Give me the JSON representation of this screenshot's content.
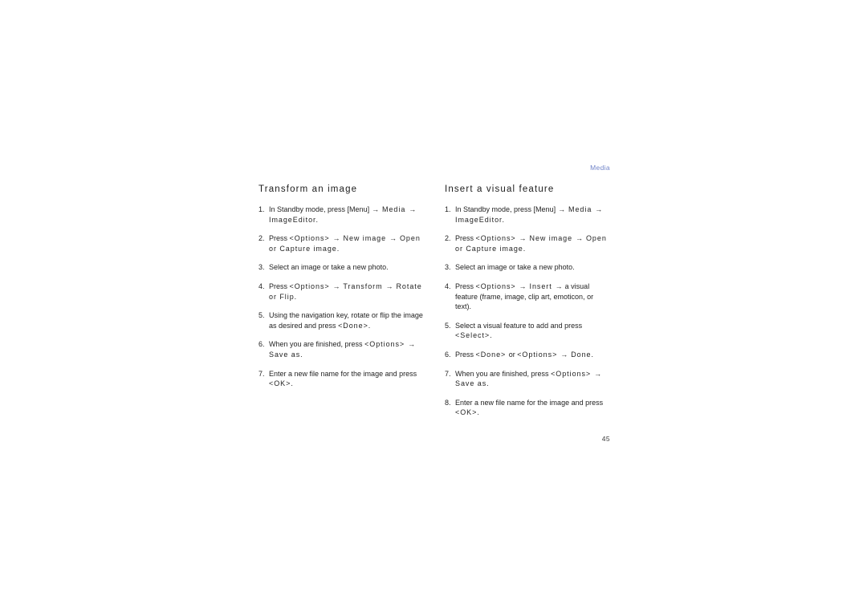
{
  "header": {
    "running_head": "Media",
    "running_head_color": "#7184c9"
  },
  "page_number": "45",
  "columns": [
    {
      "id": "transform-an-image",
      "title": "Transform an image",
      "steps": [
        {
          "num": "1.",
          "parts": [
            {
              "text": "In Standby mode, press [Menu] ",
              "style": "normal"
            },
            {
              "text": "→",
              "style": "arrow"
            },
            {
              "text": " Media ",
              "style": "menu"
            },
            {
              "text": "→",
              "style": "arrow"
            },
            {
              "text": " ImageEditor.",
              "style": "menu"
            }
          ]
        },
        {
          "num": "2.",
          "parts": [
            {
              "text": "Press ",
              "style": "normal"
            },
            {
              "text": "<Options> ",
              "style": "menu"
            },
            {
              "text": "→",
              "style": "arrow"
            },
            {
              "text": " New image ",
              "style": "menu"
            },
            {
              "text": "→",
              "style": "arrow"
            },
            {
              "text": " Open or Capture image.",
              "style": "menu"
            }
          ]
        },
        {
          "num": "3.",
          "parts": [
            {
              "text": "Select an image or take a new photo.",
              "style": "normal"
            }
          ]
        },
        {
          "num": "4.",
          "parts": [
            {
              "text": "Press ",
              "style": "normal"
            },
            {
              "text": "<Options> ",
              "style": "menu"
            },
            {
              "text": "→",
              "style": "arrow"
            },
            {
              "text": " Transform ",
              "style": "menu"
            },
            {
              "text": "→",
              "style": "arrow"
            },
            {
              "text": " Rotate or Flip.",
              "style": "menu"
            }
          ]
        },
        {
          "num": "5.",
          "parts": [
            {
              "text": "Using the navigation key, rotate or flip the image as desired and press ",
              "style": "normal"
            },
            {
              "text": "<Done>.",
              "style": "menu"
            }
          ]
        },
        {
          "num": "6.",
          "parts": [
            {
              "text": "When you are finished, press ",
              "style": "normal"
            },
            {
              "text": "<Options> ",
              "style": "menu"
            },
            {
              "text": "→",
              "style": "arrow"
            },
            {
              "text": " Save as.",
              "style": "menu"
            }
          ]
        },
        {
          "num": "7.",
          "parts": [
            {
              "text": "Enter a new file name for the image and press ",
              "style": "normal"
            },
            {
              "text": "<OK>.",
              "style": "menu"
            }
          ]
        }
      ]
    },
    {
      "id": "insert-a-visual-feature",
      "title": "Insert a visual feature",
      "steps": [
        {
          "num": "1.",
          "parts": [
            {
              "text": "In Standby mode, press [Menu] ",
              "style": "normal"
            },
            {
              "text": "→",
              "style": "arrow"
            },
            {
              "text": " Media ",
              "style": "menu"
            },
            {
              "text": "→",
              "style": "arrow"
            },
            {
              "text": " ImageEditor.",
              "style": "menu"
            }
          ]
        },
        {
          "num": "2.",
          "parts": [
            {
              "text": "Press ",
              "style": "normal"
            },
            {
              "text": "<Options> ",
              "style": "menu"
            },
            {
              "text": "→",
              "style": "arrow"
            },
            {
              "text": " New image ",
              "style": "menu"
            },
            {
              "text": "→",
              "style": "arrow"
            },
            {
              "text": " Open or Capture image.",
              "style": "menu"
            }
          ]
        },
        {
          "num": "3.",
          "parts": [
            {
              "text": "Select an image or take a new photo.",
              "style": "normal"
            }
          ]
        },
        {
          "num": "4.",
          "parts": [
            {
              "text": "Press ",
              "style": "normal"
            },
            {
              "text": "<Options> ",
              "style": "menu"
            },
            {
              "text": "→",
              "style": "arrow"
            },
            {
              "text": " Insert ",
              "style": "menu"
            },
            {
              "text": "→",
              "style": "arrow"
            },
            {
              "text": " a visual feature (frame, image, clip art, emoticon, or text).",
              "style": "normal"
            }
          ]
        },
        {
          "num": "5.",
          "parts": [
            {
              "text": "Select a visual feature to add and press ",
              "style": "normal"
            },
            {
              "text": "<Select>.",
              "style": "menu"
            }
          ]
        },
        {
          "num": "6.",
          "parts": [
            {
              "text": "Press ",
              "style": "normal"
            },
            {
              "text": "<Done> ",
              "style": "menu"
            },
            {
              "text": "or ",
              "style": "normal"
            },
            {
              "text": "<Options> ",
              "style": "menu"
            },
            {
              "text": "→",
              "style": "arrow"
            },
            {
              "text": " Done.",
              "style": "menu"
            }
          ]
        },
        {
          "num": "7.",
          "parts": [
            {
              "text": "When you are finished, press ",
              "style": "normal"
            },
            {
              "text": "<Options> ",
              "style": "menu"
            },
            {
              "text": "→",
              "style": "arrow"
            },
            {
              "text": " Save as.",
              "style": "menu"
            }
          ]
        },
        {
          "num": "8.",
          "parts": [
            {
              "text": "Enter a new file name for the image and press ",
              "style": "normal"
            },
            {
              "text": "<OK>.",
              "style": "menu"
            }
          ]
        }
      ]
    }
  ]
}
